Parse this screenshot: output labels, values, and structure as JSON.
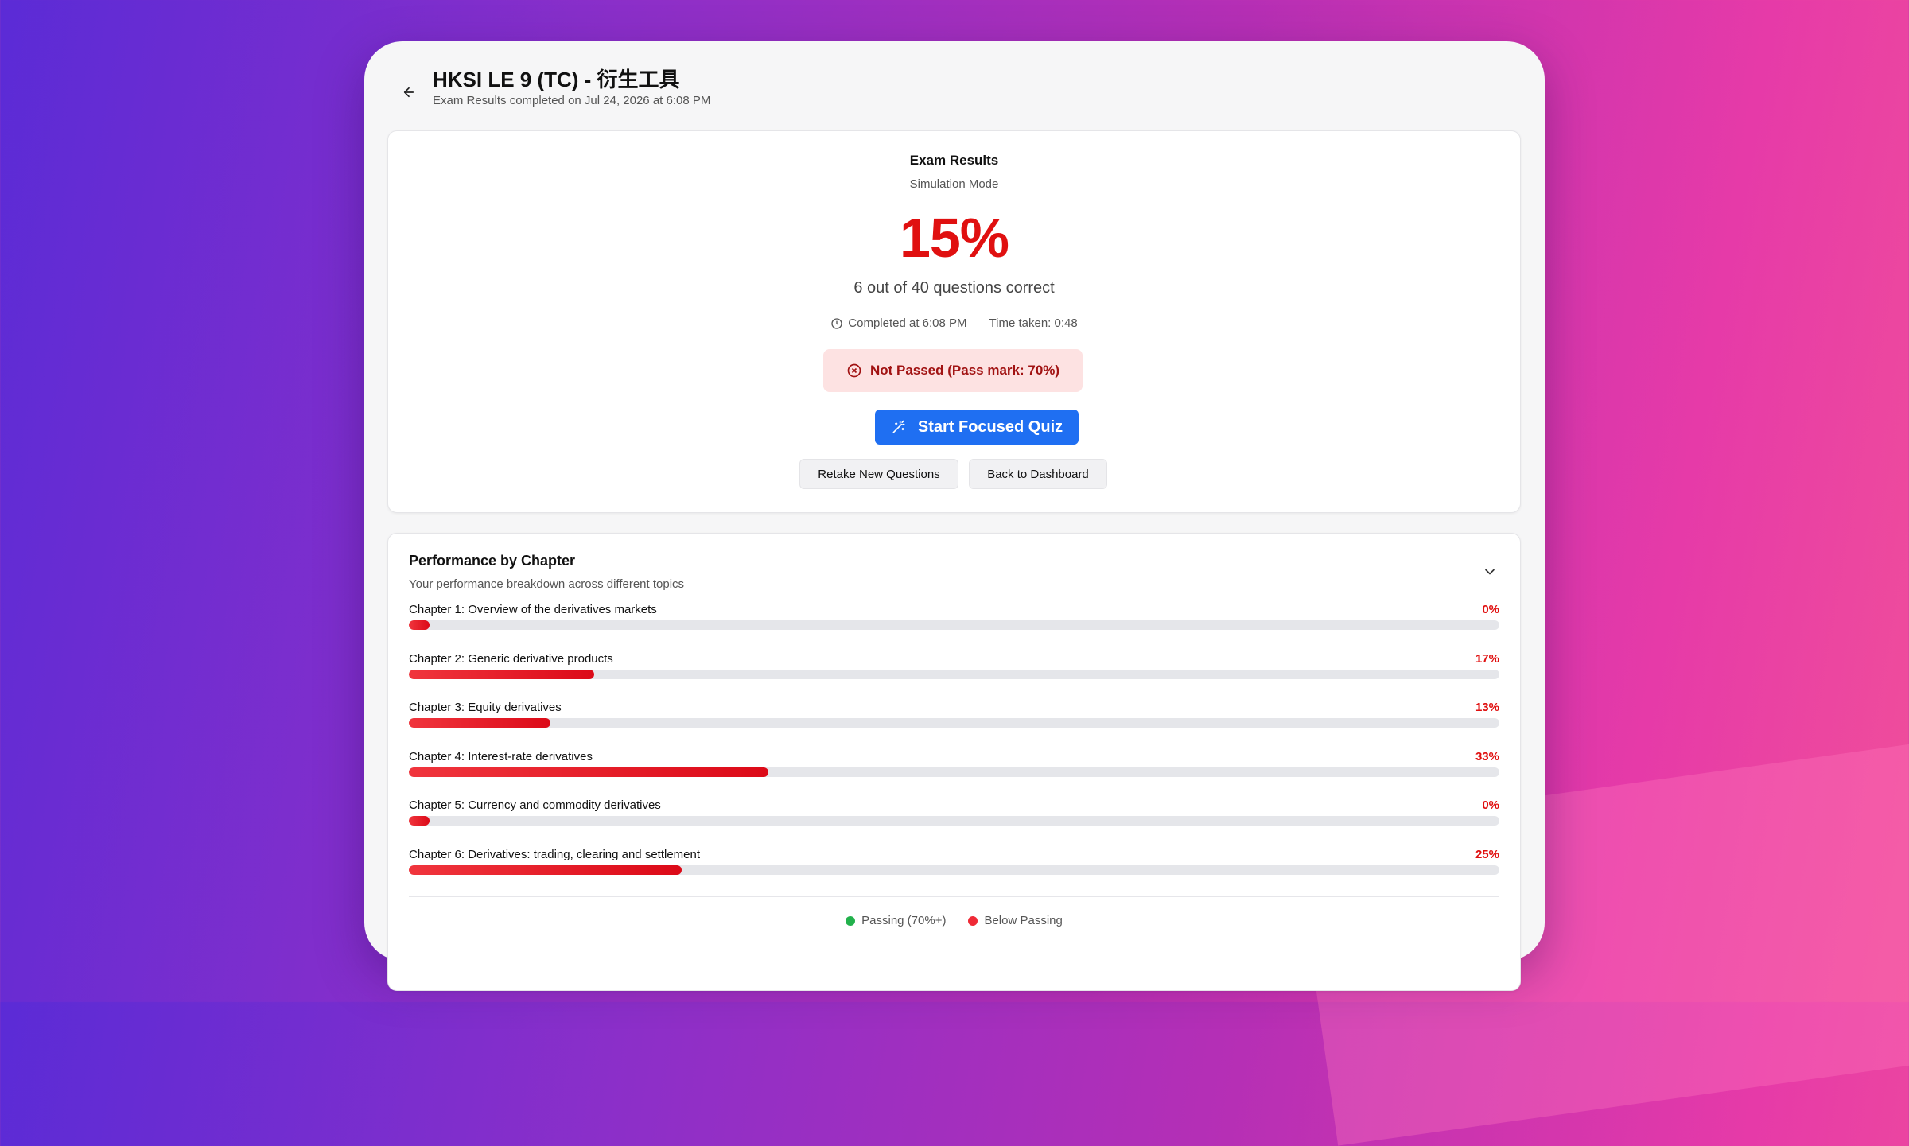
{
  "header": {
    "title": "HKSI LE 9 (TC) - 衍生工具",
    "subtitle": "Exam Results completed on Jul 24, 2026 at 6:08 PM"
  },
  "results": {
    "title": "Exam Results",
    "mode": "Simulation Mode",
    "score": "15%",
    "correct_text": "6 out of 40 questions correct",
    "completed_text": "Completed at 6:08 PM",
    "time_taken_text": "Time taken: 0:48",
    "status_text": "Not Passed (Pass mark: 70%)",
    "primary_button": "Start Focused Quiz",
    "retake_button": "Retake New Questions",
    "dashboard_button": "Back to Dashboard"
  },
  "performance": {
    "title": "Performance by Chapter",
    "subtitle": "Your performance breakdown across different topics",
    "chapters": [
      {
        "label": "Chapter 1: Overview of the derivatives markets",
        "pct_text": "0%",
        "pct": 0
      },
      {
        "label": "Chapter 2: Generic derivative products",
        "pct_text": "17%",
        "pct": 17
      },
      {
        "label": "Chapter 3: Equity derivatives",
        "pct_text": "13%",
        "pct": 13
      },
      {
        "label": "Chapter 4: Interest-rate derivatives",
        "pct_text": "33%",
        "pct": 33
      },
      {
        "label": "Chapter 5: Currency and commodity derivatives",
        "pct_text": "0%",
        "pct": 0
      },
      {
        "label": "Chapter 6: Derivatives: trading, clearing and settlement",
        "pct_text": "25%",
        "pct": 25
      }
    ],
    "legend": {
      "passing": "Passing (70%+)",
      "below": "Below Passing"
    }
  },
  "colors": {
    "accent": "#1f6ff2",
    "fail": "#e01010",
    "pass": "#22b14c"
  }
}
